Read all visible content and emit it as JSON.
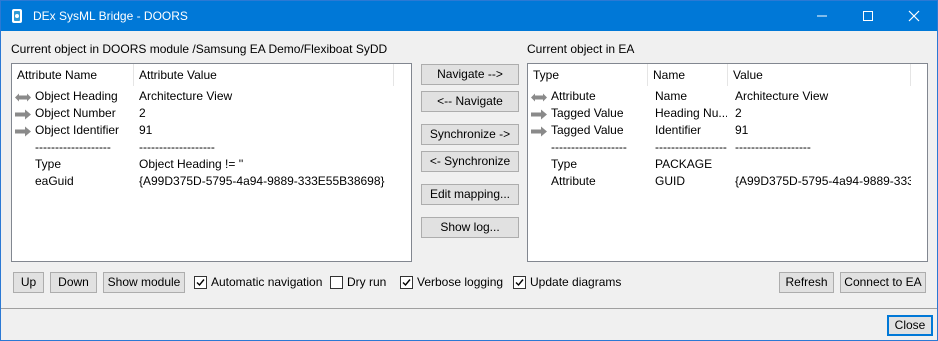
{
  "window": {
    "title": "DEx SysML Bridge - DOORS",
    "controls": {
      "minimize": "minimize",
      "maximize": "maximize",
      "close": "close"
    }
  },
  "doors_panel": {
    "label": "Current object in DOORS module /Samsung EA Demo/Flexiboat SyDD",
    "columns": [
      "Attribute Name",
      "Attribute Value"
    ],
    "rows": [
      {
        "arrow": "double-arrow",
        "name": "Object Heading",
        "value": "Architecture View"
      },
      {
        "arrow": "right-arrow",
        "name": "Object Number",
        "value": "2"
      },
      {
        "arrow": "right-arrow",
        "name": "Object Identifier",
        "value": "91"
      },
      {
        "arrow": "",
        "name": "-------------------",
        "value": "-------------------"
      },
      {
        "arrow": "",
        "name": "Type",
        "value": "Object Heading != ''"
      },
      {
        "arrow": "",
        "name": "eaGuid",
        "value": "{A99D375D-5795-4a94-9889-333E55B38698}"
      }
    ]
  },
  "ea_panel": {
    "label": "Current object in EA",
    "columns": [
      "Type",
      "Name",
      "Value"
    ],
    "rows": [
      {
        "arrow": "double-arrow",
        "type": "Attribute",
        "name": "Name",
        "value": "Architecture View"
      },
      {
        "arrow": "right-arrow",
        "type": "Tagged Value",
        "name": "Heading Nu...",
        "value": "2"
      },
      {
        "arrow": "right-arrow",
        "type": "Tagged Value",
        "name": "Identifier",
        "value": "91"
      },
      {
        "arrow": "",
        "type": "-------------------",
        "name": "-------------------",
        "value": "-------------------"
      },
      {
        "arrow": "",
        "type": "Type",
        "name": "PACKAGE",
        "value": ""
      },
      {
        "arrow": "",
        "type": "Attribute",
        "name": "GUID",
        "value": "{A99D375D-5795-4a94-9889-333..."
      }
    ]
  },
  "middle_buttons": {
    "navigate_right": "Navigate -->",
    "navigate_left": "<-- Navigate",
    "sync_right": "Synchronize ->",
    "sync_left": "<- Synchronize",
    "edit_mapping": "Edit mapping...",
    "show_log": "Show log..."
  },
  "bottom_bar": {
    "up": "Up",
    "down": "Down",
    "show_module": "Show module",
    "automatic_navigation": {
      "label": "Automatic navigation",
      "checked": true
    },
    "dry_run": {
      "label": "Dry run",
      "checked": false
    },
    "verbose_logging": {
      "label": "Verbose logging",
      "checked": true
    },
    "update_diagrams": {
      "label": "Update diagrams",
      "checked": true
    },
    "refresh": "Refresh",
    "connect": "Connect to EA",
    "close": "Close"
  },
  "colors": {
    "titlebar": "#0078d7",
    "arrow": "#8a8a8a",
    "window_bg": "#f0f0f0",
    "default_button_border": "#0078d7"
  }
}
